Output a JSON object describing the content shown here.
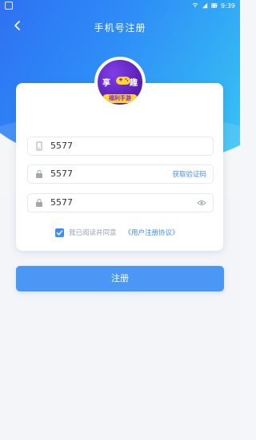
{
  "status": {
    "time": "9:39"
  },
  "header": {
    "title": "手机号注册"
  },
  "logo": {
    "left_char": "享",
    "right_char": "趣",
    "banner_text": "福利手游"
  },
  "form": {
    "phone_value": "5577",
    "code_value": "5577",
    "code_action_label": "获取验证码",
    "password_value": "5577"
  },
  "agreement": {
    "checked": true,
    "text": "我已阅读并同意",
    "link_text": "《用户注册协议》"
  },
  "actions": {
    "register_label": "注册"
  },
  "colors": {
    "accent": "#4b97f6",
    "link": "#3b8dfa"
  }
}
